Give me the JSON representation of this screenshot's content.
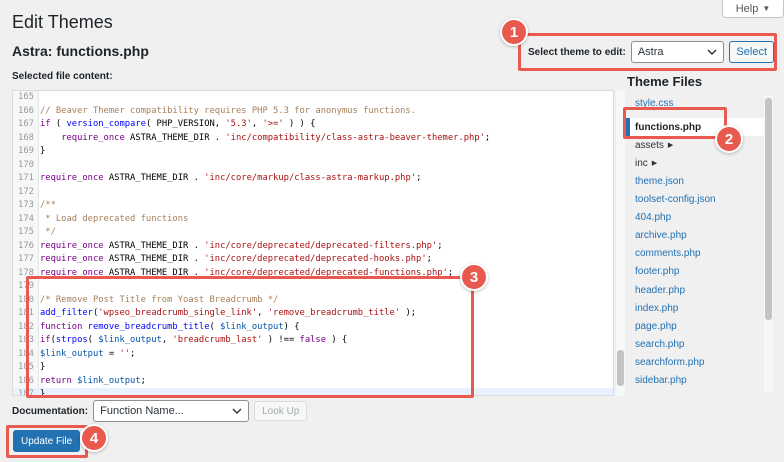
{
  "help": {
    "label": "Help"
  },
  "page_title": "Edit Themes",
  "file_title": "Astra: functions.php",
  "selected_file_label": "Selected file content:",
  "theme_select": {
    "label": "Select theme to edit:",
    "value": "Astra",
    "button": "Select"
  },
  "theme_files": {
    "title": "Theme Files",
    "items": [
      {
        "label": "style.css",
        "type": "file"
      },
      {
        "label": "functions.php",
        "type": "current"
      },
      {
        "label": "assets",
        "type": "folder"
      },
      {
        "label": "inc",
        "type": "folder"
      },
      {
        "label": "theme.json",
        "type": "file"
      },
      {
        "label": "toolset-config.json",
        "type": "file"
      },
      {
        "label": "404.php",
        "type": "file"
      },
      {
        "label": "archive.php",
        "type": "file"
      },
      {
        "label": "comments.php",
        "type": "file"
      },
      {
        "label": "footer.php",
        "type": "file"
      },
      {
        "label": "header.php",
        "type": "file"
      },
      {
        "label": "index.php",
        "type": "file"
      },
      {
        "label": "page.php",
        "type": "file"
      },
      {
        "label": "search.php",
        "type": "file"
      },
      {
        "label": "searchform.php",
        "type": "file"
      },
      {
        "label": "sidebar.php",
        "type": "file"
      }
    ]
  },
  "code_lines": [
    {
      "n": "165",
      "tokens": []
    },
    {
      "n": "166",
      "tokens": [
        {
          "t": "// Beaver Themer compatibility requires PHP 5.3 for anonymus functions.",
          "c": "c-com"
        }
      ]
    },
    {
      "n": "167",
      "tokens": [
        {
          "t": "if",
          "c": "c-kw"
        },
        {
          "t": " ( ",
          "c": "c-plain"
        },
        {
          "t": "version_compare",
          "c": "c-fn"
        },
        {
          "t": "( PHP_VERSION, ",
          "c": "c-plain"
        },
        {
          "t": "'5.3'",
          "c": "c-str"
        },
        {
          "t": ", ",
          "c": "c-plain"
        },
        {
          "t": "'>='",
          "c": "c-str"
        },
        {
          "t": " ) ) {",
          "c": "c-plain"
        }
      ]
    },
    {
      "n": "168",
      "tokens": [
        {
          "t": "    ",
          "c": "c-plain"
        },
        {
          "t": "require_once",
          "c": "c-kw"
        },
        {
          "t": " ASTRA_THEME_DIR . ",
          "c": "c-plain"
        },
        {
          "t": "'inc/compatibility/class-astra-beaver-themer.php'",
          "c": "c-str"
        },
        {
          "t": ";",
          "c": "c-plain"
        }
      ]
    },
    {
      "n": "169",
      "tokens": [
        {
          "t": "}",
          "c": "c-plain"
        }
      ]
    },
    {
      "n": "170",
      "tokens": []
    },
    {
      "n": "171",
      "tokens": [
        {
          "t": "require_once",
          "c": "c-kw"
        },
        {
          "t": " ASTRA_THEME_DIR . ",
          "c": "c-plain"
        },
        {
          "t": "'inc/core/markup/class-astra-markup.php'",
          "c": "c-str"
        },
        {
          "t": ";",
          "c": "c-plain"
        }
      ]
    },
    {
      "n": "172",
      "tokens": []
    },
    {
      "n": "173",
      "tokens": [
        {
          "t": "/**",
          "c": "c-com"
        }
      ]
    },
    {
      "n": "174",
      "tokens": [
        {
          "t": " * Load deprecated functions",
          "c": "c-com"
        }
      ]
    },
    {
      "n": "175",
      "tokens": [
        {
          "t": " */",
          "c": "c-com"
        }
      ]
    },
    {
      "n": "176",
      "tokens": [
        {
          "t": "require_once",
          "c": "c-kw"
        },
        {
          "t": " ASTRA_THEME_DIR . ",
          "c": "c-plain"
        },
        {
          "t": "'inc/core/deprecated/deprecated-filters.php'",
          "c": "c-str"
        },
        {
          "t": ";",
          "c": "c-plain"
        }
      ]
    },
    {
      "n": "177",
      "tokens": [
        {
          "t": "require_once",
          "c": "c-kw"
        },
        {
          "t": " ASTRA_THEME_DIR . ",
          "c": "c-plain"
        },
        {
          "t": "'inc/core/deprecated/deprecated-hooks.php'",
          "c": "c-str"
        },
        {
          "t": ";",
          "c": "c-plain"
        }
      ]
    },
    {
      "n": "178",
      "tokens": [
        {
          "t": "require_once",
          "c": "c-kw"
        },
        {
          "t": " ASTRA_THEME_DIR . ",
          "c": "c-plain"
        },
        {
          "t": "'inc/core/deprecated/deprecated-functions.php'",
          "c": "c-str"
        },
        {
          "t": ";",
          "c": "c-plain"
        }
      ]
    },
    {
      "n": "179",
      "tokens": []
    },
    {
      "n": "180",
      "tokens": [
        {
          "t": "/* Remove Post Title from Yoast Breadcrumb */",
          "c": "c-com"
        }
      ]
    },
    {
      "n": "181",
      "tokens": [
        {
          "t": "add_filter",
          "c": "c-fn"
        },
        {
          "t": "(",
          "c": "c-plain"
        },
        {
          "t": "'wpseo_breadcrumb_single_link'",
          "c": "c-str"
        },
        {
          "t": ", ",
          "c": "c-plain"
        },
        {
          "t": "'remove_breadcrumb_title'",
          "c": "c-str"
        },
        {
          "t": " );",
          "c": "c-plain"
        }
      ]
    },
    {
      "n": "182",
      "tokens": [
        {
          "t": "function",
          "c": "c-kw"
        },
        {
          "t": " ",
          "c": "c-plain"
        },
        {
          "t": "remove_breadcrumb_title",
          "c": "c-fn"
        },
        {
          "t": "( ",
          "c": "c-plain"
        },
        {
          "t": "$link_output",
          "c": "c-var"
        },
        {
          "t": ") {",
          "c": "c-plain"
        }
      ]
    },
    {
      "n": "183",
      "tokens": [
        {
          "t": "if",
          "c": "c-kw"
        },
        {
          "t": "(",
          "c": "c-plain"
        },
        {
          "t": "strpos",
          "c": "c-fn"
        },
        {
          "t": "( ",
          "c": "c-plain"
        },
        {
          "t": "$link_output",
          "c": "c-var"
        },
        {
          "t": ", ",
          "c": "c-plain"
        },
        {
          "t": "'breadcrumb_last'",
          "c": "c-str"
        },
        {
          "t": " ) !== ",
          "c": "c-plain"
        },
        {
          "t": "false",
          "c": "c-kw"
        },
        {
          "t": " ) {",
          "c": "c-plain"
        }
      ]
    },
    {
      "n": "184",
      "tokens": [
        {
          "t": "$link_output",
          "c": "c-var"
        },
        {
          "t": " = ",
          "c": "c-plain"
        },
        {
          "t": "''",
          "c": "c-str"
        },
        {
          "t": ";",
          "c": "c-plain"
        }
      ]
    },
    {
      "n": "185",
      "tokens": [
        {
          "t": "}",
          "c": "c-plain"
        }
      ]
    },
    {
      "n": "186",
      "tokens": [
        {
          "t": "return",
          "c": "c-kw"
        },
        {
          "t": " ",
          "c": "c-plain"
        },
        {
          "t": "$link_output",
          "c": "c-var"
        },
        {
          "t": ";",
          "c": "c-plain"
        }
      ]
    },
    {
      "n": "187",
      "tokens": [
        {
          "t": "}",
          "c": "c-plain"
        }
      ]
    }
  ],
  "documentation": {
    "label": "Documentation:",
    "placeholder": "Function Name...",
    "button": "Look Up"
  },
  "update_button": "Update File",
  "annotations": [
    "1",
    "2",
    "3",
    "4"
  ],
  "colors": {
    "accent": "#2271b1",
    "highlight": "#e85a4f"
  }
}
